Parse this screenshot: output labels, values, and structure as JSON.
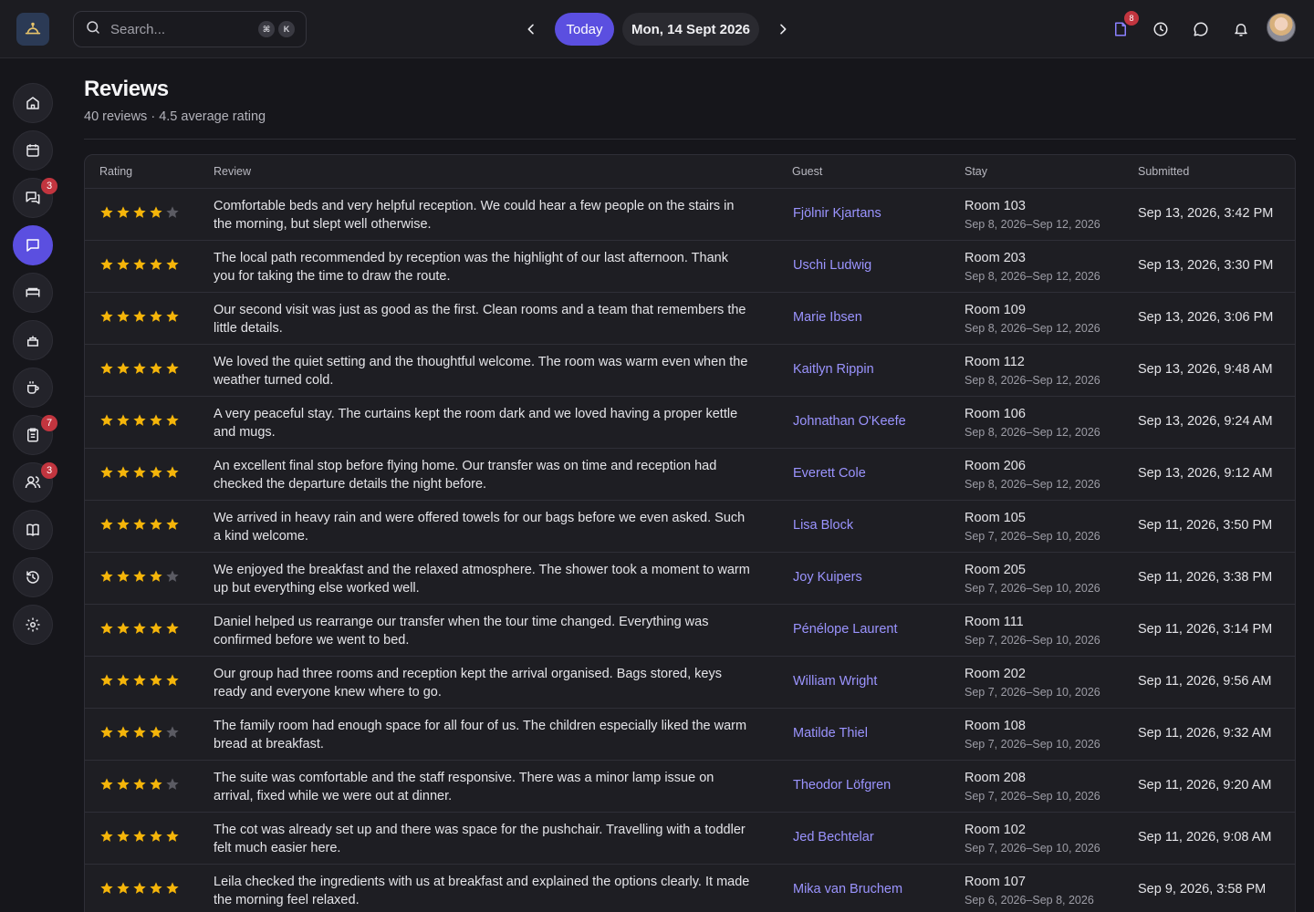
{
  "topbar": {
    "search_placeholder": "Search...",
    "shortcut_keys": [
      "⌘",
      "K"
    ],
    "today_label": "Today",
    "date_label": "Mon, 14 Sept 2026",
    "notes_badge": "8"
  },
  "sidebar": {
    "badges": {
      "messages": "3",
      "tasks": "7",
      "guests": "3"
    }
  },
  "page": {
    "title": "Reviews",
    "subtitle": "40 reviews · 4.5 average rating"
  },
  "table": {
    "headers": {
      "rating": "Rating",
      "review": "Review",
      "guest": "Guest",
      "stay": "Stay",
      "submitted": "Submitted"
    },
    "rows": [
      {
        "rating": 4,
        "review": "Comfortable beds and very helpful reception. We could hear a few people on the stairs in the morning, but slept well otherwise.",
        "guest": "Fjölnir Kjartans",
        "room": "Room 103",
        "dates": "Sep 8, 2026–Sep 12, 2026",
        "submitted": "Sep 13, 2026, 3:42 PM"
      },
      {
        "rating": 5,
        "review": "The local path recommended by reception was the highlight of our last afternoon. Thank you for taking the time to draw the route.",
        "guest": "Uschi Ludwig",
        "room": "Room 203",
        "dates": "Sep 8, 2026–Sep 12, 2026",
        "submitted": "Sep 13, 2026, 3:30 PM"
      },
      {
        "rating": 5,
        "review": "Our second visit was just as good as the first. Clean rooms and a team that remembers the little details.",
        "guest": "Marie Ibsen",
        "room": "Room 109",
        "dates": "Sep 8, 2026–Sep 12, 2026",
        "submitted": "Sep 13, 2026, 3:06 PM"
      },
      {
        "rating": 5,
        "review": "We loved the quiet setting and the thoughtful welcome. The room was warm even when the weather turned cold.",
        "guest": "Kaitlyn Rippin",
        "room": "Room 112",
        "dates": "Sep 8, 2026–Sep 12, 2026",
        "submitted": "Sep 13, 2026, 9:48 AM"
      },
      {
        "rating": 5,
        "review": "A very peaceful stay. The curtains kept the room dark and we loved having a proper kettle and mugs.",
        "guest": "Johnathan O'Keefe",
        "room": "Room 106",
        "dates": "Sep 8, 2026–Sep 12, 2026",
        "submitted": "Sep 13, 2026, 9:24 AM"
      },
      {
        "rating": 5,
        "review": "An excellent final stop before flying home. Our transfer was on time and reception had checked the departure details the night before.",
        "guest": "Everett Cole",
        "room": "Room 206",
        "dates": "Sep 8, 2026–Sep 12, 2026",
        "submitted": "Sep 13, 2026, 9:12 AM"
      },
      {
        "rating": 5,
        "review": "We arrived in heavy rain and were offered towels for our bags before we even asked. Such a kind welcome.",
        "guest": "Lisa Block",
        "room": "Room 105",
        "dates": "Sep 7, 2026–Sep 10, 2026",
        "submitted": "Sep 11, 2026, 3:50 PM"
      },
      {
        "rating": 4,
        "review": "We enjoyed the breakfast and the relaxed atmosphere. The shower took a moment to warm up but everything else worked well.",
        "guest": "Joy Kuipers",
        "room": "Room 205",
        "dates": "Sep 7, 2026–Sep 10, 2026",
        "submitted": "Sep 11, 2026, 3:38 PM"
      },
      {
        "rating": 5,
        "review": "Daniel helped us rearrange our transfer when the tour time changed. Everything was confirmed before we went to bed.",
        "guest": "Pénélope Laurent",
        "room": "Room 111",
        "dates": "Sep 7, 2026–Sep 10, 2026",
        "submitted": "Sep 11, 2026, 3:14 PM"
      },
      {
        "rating": 5,
        "review": "Our group had three rooms and reception kept the arrival organised. Bags stored, keys ready and everyone knew where to go.",
        "guest": "William Wright",
        "room": "Room 202",
        "dates": "Sep 7, 2026–Sep 10, 2026",
        "submitted": "Sep 11, 2026, 9:56 AM"
      },
      {
        "rating": 4,
        "review": "The family room had enough space for all four of us. The children especially liked the warm bread at breakfast.",
        "guest": "Matilde Thiel",
        "room": "Room 108",
        "dates": "Sep 7, 2026–Sep 10, 2026",
        "submitted": "Sep 11, 2026, 9:32 AM"
      },
      {
        "rating": 4,
        "review": "The suite was comfortable and the staff responsive. There was a minor lamp issue on arrival, fixed while we were out at dinner.",
        "guest": "Theodor Löfgren",
        "room": "Room 208",
        "dates": "Sep 7, 2026–Sep 10, 2026",
        "submitted": "Sep 11, 2026, 9:20 AM"
      },
      {
        "rating": 5,
        "review": "The cot was already set up and there was space for the pushchair. Travelling with a toddler felt much easier here.",
        "guest": "Jed Bechtelar",
        "room": "Room 102",
        "dates": "Sep 7, 2026–Sep 10, 2026",
        "submitted": "Sep 11, 2026, 9:08 AM"
      },
      {
        "rating": 5,
        "review": "Leila checked the ingredients with us at breakfast and explained the options clearly. It made the morning feel relaxed.",
        "guest": "Mika van Bruchem",
        "room": "Room 107",
        "dates": "Sep 6, 2026–Sep 8, 2026",
        "submitted": "Sep 9, 2026, 3:58 PM"
      }
    ]
  },
  "colors": {
    "accent": "#5b4fe0",
    "star_filled": "#f5b50a",
    "star_empty": "#5b5b63",
    "guest_link": "#9b94ff",
    "badge": "#c2353f"
  }
}
